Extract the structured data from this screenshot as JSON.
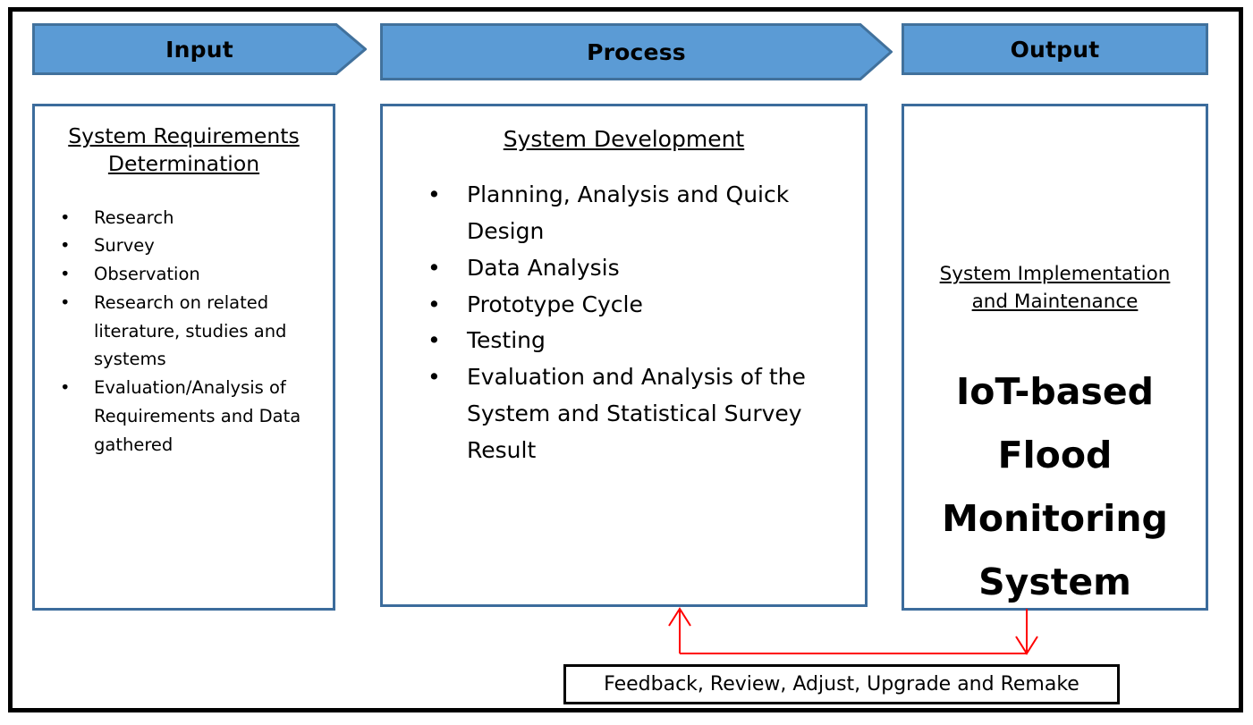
{
  "diagram": {
    "title": "Input Process Output Diagram",
    "colors": {
      "banner_fill": "#5B9BD5",
      "banner_stroke": "#41719C",
      "panel_border": "#3C6C9C",
      "frame": "#000000",
      "feedback_arrow": "#FF0000",
      "text": "#000000"
    }
  },
  "banners": [
    {
      "id": "input",
      "label": "Input",
      "shape": "arrow-right"
    },
    {
      "id": "process",
      "label": "Process",
      "shape": "arrow-right"
    },
    {
      "id": "output",
      "label": "Output",
      "shape": "rectangle"
    }
  ],
  "input_panel": {
    "title_line1": "System Requirements",
    "title_line2": "Determination",
    "bullets": [
      "Research",
      "Survey",
      "Observation",
      "Research on related literature, studies and systems",
      "Evaluation/Analysis of Requirements and Data gathered"
    ],
    "bullet_glyph": "•"
  },
  "process_panel": {
    "title": "System Development",
    "bullets": [
      "Planning, Analysis and Quick Design",
      "Data Analysis",
      "Prototype Cycle",
      "Testing",
      "Evaluation and Analysis of the System and Statistical Survey Result"
    ],
    "bullet_glyph": "•"
  },
  "output_panel": {
    "subtitle_line1": "System Implementation ",
    "subtitle_line2": "and Maintenance",
    "result_line1": "IoT-based",
    "result_line2": "Flood",
    "result_line3": "Monitoring",
    "result_line4": "System"
  },
  "feedback": {
    "label": "Feedback, Review, Adjust, Upgrade and Remake",
    "arrow_up_name": "feedback-to-process-arrow",
    "arrow_down_name": "output-to-feedback-arrow"
  }
}
